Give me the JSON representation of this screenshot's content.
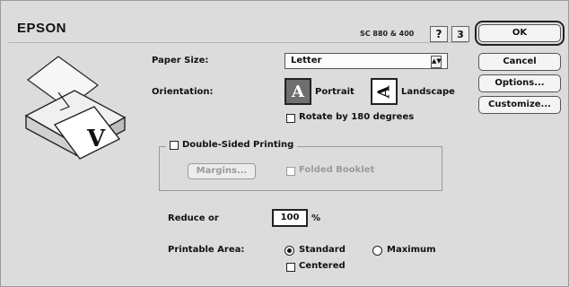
{
  "header": {
    "brand": "EPSON",
    "model": "SC 880 & 400",
    "help_label": "?",
    "version_label": "3"
  },
  "buttons": {
    "ok": "OK",
    "cancel": "Cancel",
    "options": "Options...",
    "customize": "Customize..."
  },
  "paper": {
    "label": "Paper Size:",
    "value": "Letter"
  },
  "orientation": {
    "label": "Orientation:",
    "portrait": "Portrait",
    "landscape": "Landscape",
    "selected": "portrait",
    "rotate_label": "Rotate by 180 degrees",
    "portrait_glyph": "A",
    "landscape_glyph": "A"
  },
  "duplex": {
    "title": "Double-Sided Printing",
    "margins_label": "Margins...",
    "folded_label": "Folded Booklet"
  },
  "reduce": {
    "label": "Reduce or",
    "value": "100",
    "unit": "%"
  },
  "printable": {
    "label": "Printable Area:",
    "standard": "Standard",
    "maximum": "Maximum",
    "centered": "Centered"
  },
  "illustration": {
    "glyph": "V"
  }
}
